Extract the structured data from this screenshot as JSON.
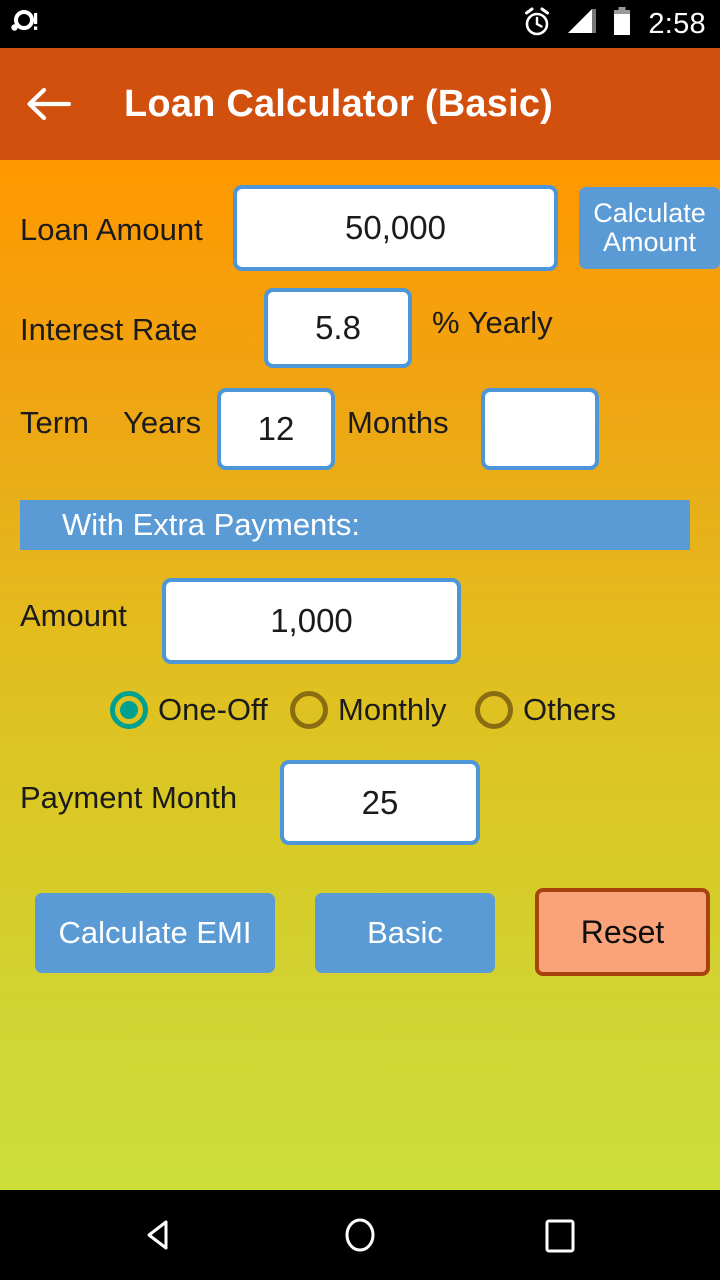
{
  "status_bar": {
    "notification_icon": "alert-circle-icon",
    "alarm_icon": "alarm-clock-icon",
    "signal_icon": "signal-bars-icon",
    "battery_icon": "battery-icon",
    "time": "2:58"
  },
  "app_bar": {
    "back_icon": "back-arrow-icon",
    "title": "Loan Calculator (Basic)",
    "background_color": "#D2500E"
  },
  "form": {
    "loan_amount": {
      "label": "Loan Amount",
      "value": "50,000",
      "placeholder": "",
      "action_button": "Calculate Amount"
    },
    "interest_rate": {
      "label": "Interest Rate",
      "value": "5.8",
      "placeholder": "",
      "suffix": "% Yearly"
    },
    "term": {
      "label": "Term",
      "years_label": "Years",
      "years_value": "12",
      "months_label": "Months",
      "months_value": "",
      "months_placeholder": ""
    }
  },
  "extra_payments": {
    "banner_title": "With Extra Payments:",
    "banner_color": "#5B9BD5",
    "amount": {
      "label": "Amount",
      "value": "1,000",
      "placeholder": ""
    },
    "payment_type": {
      "selected": "One-Off",
      "options": [
        {
          "label": "One-Off",
          "checked": true
        },
        {
          "label": "Monthly",
          "checked": false
        },
        {
          "label": "Others",
          "checked": false
        }
      ],
      "selected_color": "#00A08F",
      "unselected_color": "#8A6D12"
    },
    "payment_month": {
      "label": "Payment Month",
      "value": "25",
      "placeholder": ""
    }
  },
  "actions": {
    "calculate_emi": "Calculate EMI",
    "basic": "Basic",
    "reset": "Reset",
    "primary_color": "#5B9BD5",
    "reset_color": "#FAA37A",
    "reset_border_color": "#A8430C"
  },
  "nav_bar": {
    "back_icon": "nav-back-triangle-icon",
    "home_icon": "nav-home-circle-icon",
    "recents_icon": "nav-recents-square-icon"
  },
  "theme": {
    "background_top": "#FF9800",
    "background_bottom": "#CEDC39",
    "input_border": "#4D96D9",
    "text_color": "#1b1b1b"
  }
}
